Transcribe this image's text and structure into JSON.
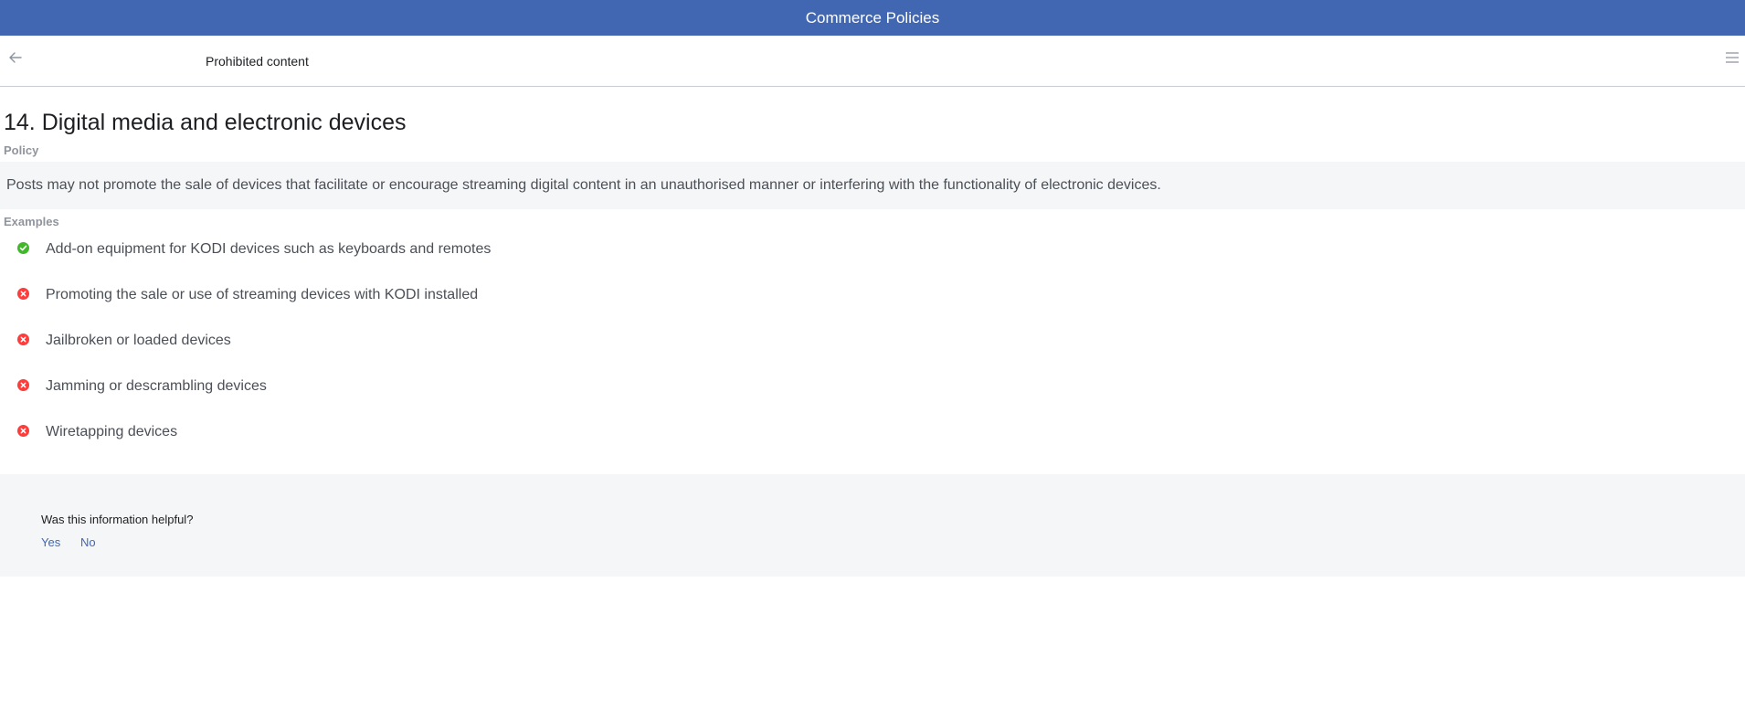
{
  "header": {
    "title": "Commerce Policies",
    "color": "#4267b2"
  },
  "subnav": {
    "title": "Prohibited content",
    "back_icon": "arrow-left-icon",
    "menu_icon": "hamburger-menu-icon"
  },
  "main": {
    "title": "14. Digital media and electronic devices",
    "policy_label": "Policy",
    "policy_text": "Posts may not promote the sale of devices that facilitate or encourage streaming digital content in an unauthorised manner or interfering with the functionality of electronic devices.",
    "examples_label": "Examples",
    "examples": [
      {
        "text": "Add-on equipment for KODI devices such as keyboards and remotes",
        "allowed": true,
        "icon": "check-circle-icon"
      },
      {
        "text": "Promoting the sale or use of streaming devices with KODI installed",
        "allowed": false,
        "icon": "x-circle-icon"
      },
      {
        "text": "Jailbroken or loaded devices",
        "allowed": false,
        "icon": "x-circle-icon"
      },
      {
        "text": "Jamming or descrambling devices",
        "allowed": false,
        "icon": "x-circle-icon"
      },
      {
        "text": "Wiretapping devices",
        "allowed": false,
        "icon": "x-circle-icon"
      }
    ]
  },
  "feedback": {
    "question": "Was this information helpful?",
    "yes_label": "Yes",
    "no_label": "No"
  },
  "colors": {
    "allowed": "#42b72a",
    "prohibited": "#fa3e3e",
    "link": "#4267b2"
  }
}
